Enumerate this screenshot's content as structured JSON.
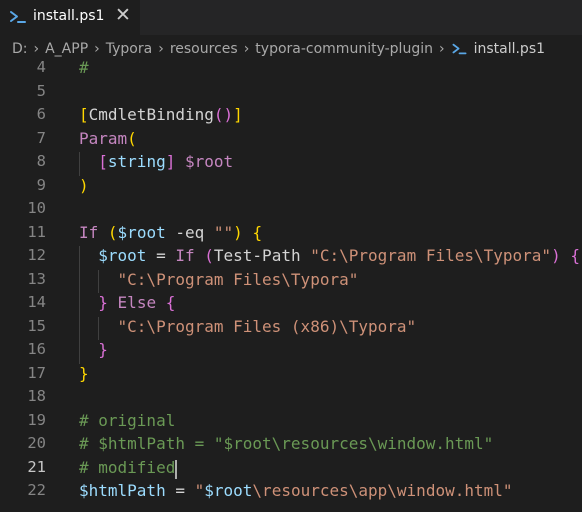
{
  "tab": {
    "label": "install.ps1",
    "close": "✕"
  },
  "breadcrumb": {
    "items": [
      "D:",
      "A_APP",
      "Typora",
      "resources",
      "typora-community-plugin"
    ],
    "file": "install.ps1",
    "separator": "›"
  },
  "editor": {
    "active_line": 21,
    "lines": [
      {
        "n": 4,
        "tokens": [
          {
            "t": "#",
            "c": "tk-comment"
          }
        ]
      },
      {
        "n": 5,
        "tokens": []
      },
      {
        "n": 6,
        "tokens": [
          {
            "t": "[",
            "c": "tk-gold"
          },
          {
            "t": "CmdletBinding",
            "c": "tk-default"
          },
          {
            "t": "()",
            "c": "tk-bracket"
          },
          {
            "t": "]",
            "c": "tk-gold"
          }
        ]
      },
      {
        "n": 7,
        "tokens": [
          {
            "t": "Param",
            "c": "tk-keyword"
          },
          {
            "t": "(",
            "c": "tk-gold"
          }
        ]
      },
      {
        "n": 8,
        "tokens": [
          {
            "t": "  ",
            "c": "tk-default"
          },
          {
            "t": "[",
            "c": "tk-bracket"
          },
          {
            "t": "string",
            "c": "tk-var"
          },
          {
            "t": "]",
            "c": "tk-bracket"
          },
          {
            "t": " ",
            "c": "tk-default"
          },
          {
            "t": "$root",
            "c": "tk-type"
          }
        ]
      },
      {
        "n": 9,
        "tokens": [
          {
            "t": ")",
            "c": "tk-gold"
          }
        ]
      },
      {
        "n": 10,
        "tokens": []
      },
      {
        "n": 11,
        "tokens": [
          {
            "t": "If",
            "c": "tk-keyword"
          },
          {
            "t": " ",
            "c": "tk-default"
          },
          {
            "t": "(",
            "c": "tk-gold"
          },
          {
            "t": "$root",
            "c": "tk-var"
          },
          {
            "t": " -eq ",
            "c": "tk-default"
          },
          {
            "t": "\"\"",
            "c": "tk-string"
          },
          {
            "t": ")",
            "c": "tk-gold"
          },
          {
            "t": " ",
            "c": "tk-default"
          },
          {
            "t": "{",
            "c": "tk-gold"
          }
        ]
      },
      {
        "n": 12,
        "tokens": [
          {
            "t": "  ",
            "c": "tk-default"
          },
          {
            "t": "$root",
            "c": "tk-var"
          },
          {
            "t": " = ",
            "c": "tk-default"
          },
          {
            "t": "If",
            "c": "tk-keyword"
          },
          {
            "t": " ",
            "c": "tk-default"
          },
          {
            "t": "(",
            "c": "tk-bracket"
          },
          {
            "t": "Test-Path",
            "c": "tk-default"
          },
          {
            "t": " ",
            "c": "tk-default"
          },
          {
            "t": "\"C:\\Program Files\\Typora\"",
            "c": "tk-string"
          },
          {
            "t": ")",
            "c": "tk-bracket"
          },
          {
            "t": " ",
            "c": "tk-default"
          },
          {
            "t": "{",
            "c": "tk-bracket"
          }
        ]
      },
      {
        "n": 13,
        "tokens": [
          {
            "t": "    ",
            "c": "tk-default"
          },
          {
            "t": "\"C:\\Program Files\\Typora\"",
            "c": "tk-string"
          }
        ]
      },
      {
        "n": 14,
        "tokens": [
          {
            "t": "  ",
            "c": "tk-default"
          },
          {
            "t": "}",
            "c": "tk-bracket"
          },
          {
            "t": " ",
            "c": "tk-default"
          },
          {
            "t": "Else",
            "c": "tk-keyword"
          },
          {
            "t": " ",
            "c": "tk-default"
          },
          {
            "t": "{",
            "c": "tk-bracket"
          }
        ]
      },
      {
        "n": 15,
        "tokens": [
          {
            "t": "    ",
            "c": "tk-default"
          },
          {
            "t": "\"C:\\Program Files (x86)\\Typora\"",
            "c": "tk-string"
          }
        ]
      },
      {
        "n": 16,
        "tokens": [
          {
            "t": "  ",
            "c": "tk-default"
          },
          {
            "t": "}",
            "c": "tk-bracket"
          }
        ]
      },
      {
        "n": 17,
        "tokens": [
          {
            "t": "}",
            "c": "tk-gold"
          }
        ]
      },
      {
        "n": 18,
        "tokens": []
      },
      {
        "n": 19,
        "tokens": [
          {
            "t": "# original",
            "c": "tk-comment"
          }
        ]
      },
      {
        "n": 20,
        "tokens": [
          {
            "t": "# $htmlPath = \"$root\\resources\\window.html\"",
            "c": "tk-comment"
          }
        ]
      },
      {
        "n": 21,
        "tokens": [
          {
            "t": "# modified",
            "c": "tk-comment"
          }
        ]
      },
      {
        "n": 22,
        "tokens": [
          {
            "t": "$htmlPath",
            "c": "tk-var"
          },
          {
            "t": " = ",
            "c": "tk-default"
          },
          {
            "t": "\"",
            "c": "tk-string"
          },
          {
            "t": "$root",
            "c": "tk-var"
          },
          {
            "t": "\\resources\\app\\window.html\"",
            "c": "tk-string"
          }
        ]
      }
    ]
  }
}
